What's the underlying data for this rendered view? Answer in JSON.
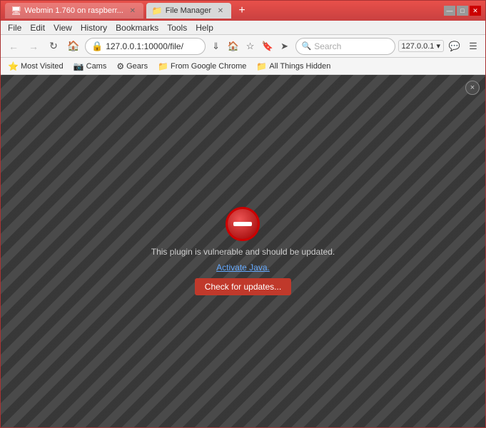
{
  "window": {
    "title": "File Manager",
    "controls": {
      "minimize": "—",
      "maximize": "□",
      "close": "✕"
    }
  },
  "tabs": [
    {
      "id": "tab-webmin",
      "label": "Webmin 1.760 on raspberr...",
      "active": false,
      "favicon": "🖥"
    },
    {
      "id": "tab-filemanager",
      "label": "File Manager",
      "active": true,
      "favicon": "📁"
    }
  ],
  "newtab": "+",
  "menu": {
    "items": [
      "File",
      "Edit",
      "View",
      "History",
      "Bookmarks",
      "Tools",
      "Help"
    ]
  },
  "addressbar": {
    "back_title": "Back",
    "forward_title": "Forward",
    "refresh_title": "Refresh",
    "home_title": "Home",
    "url": "127.0.0.1:10000/file/",
    "secure_icon": "🔒",
    "search_placeholder": "Search",
    "download_title": "Downloads",
    "bookmark_title": "Bookmark",
    "bookmarks_title": "Bookmarks",
    "send_title": "Send",
    "profile_label": "127.0.0.1 ▾",
    "chat_title": "Chat",
    "menu_title": "Menu"
  },
  "bookmarks": [
    {
      "id": "bm-most-visited",
      "icon": "⭐",
      "label": "Most Visited"
    },
    {
      "id": "bm-cams",
      "icon": "📷",
      "label": "Cams"
    },
    {
      "id": "bm-gears",
      "icon": "⚙",
      "label": "Gears"
    },
    {
      "id": "bm-from-google",
      "icon": "📁",
      "label": "From Google Chrome"
    },
    {
      "id": "bm-all-things",
      "icon": "📁",
      "label": "All Things Hidden"
    }
  ],
  "plugin_error": {
    "close_label": "×",
    "message": "This plugin is vulnerable and should be updated.",
    "activate_label": "Activate Java.",
    "update_button": "Check for updates..."
  }
}
